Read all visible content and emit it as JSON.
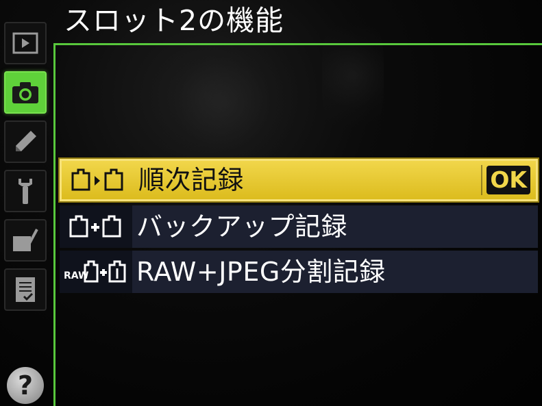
{
  "title": "スロット2の機能",
  "sidebar": {
    "tabs": [
      {
        "name": "playback-menu",
        "icon": "playback-icon"
      },
      {
        "name": "shooting-menu",
        "icon": "camera-icon",
        "active": true
      },
      {
        "name": "custom-settings-menu",
        "icon": "pencil-icon"
      },
      {
        "name": "setup-menu",
        "icon": "wrench-icon"
      },
      {
        "name": "retouch-menu",
        "icon": "retouch-brush-icon"
      },
      {
        "name": "my-menu",
        "icon": "my-menu-checklist-icon"
      }
    ],
    "help_label": "?"
  },
  "menu": {
    "items": [
      {
        "icon": "overflow-slot-icon",
        "label": "順次記録",
        "selected": true,
        "ok_label": "OK"
      },
      {
        "icon": "backup-slot-icon",
        "label": "バックアップ記録",
        "selected": false
      },
      {
        "icon": "raw-jpeg-slot-icon",
        "icon_text": "RAW",
        "label": "RAW+JPEG分割記録",
        "selected": false
      }
    ]
  },
  "colors": {
    "accent_green": "#58c83c",
    "active_tab_green": "#5fd13a",
    "selection_yellow": "#f1d64a",
    "row_background": "#1c2030",
    "background": "#000000"
  }
}
